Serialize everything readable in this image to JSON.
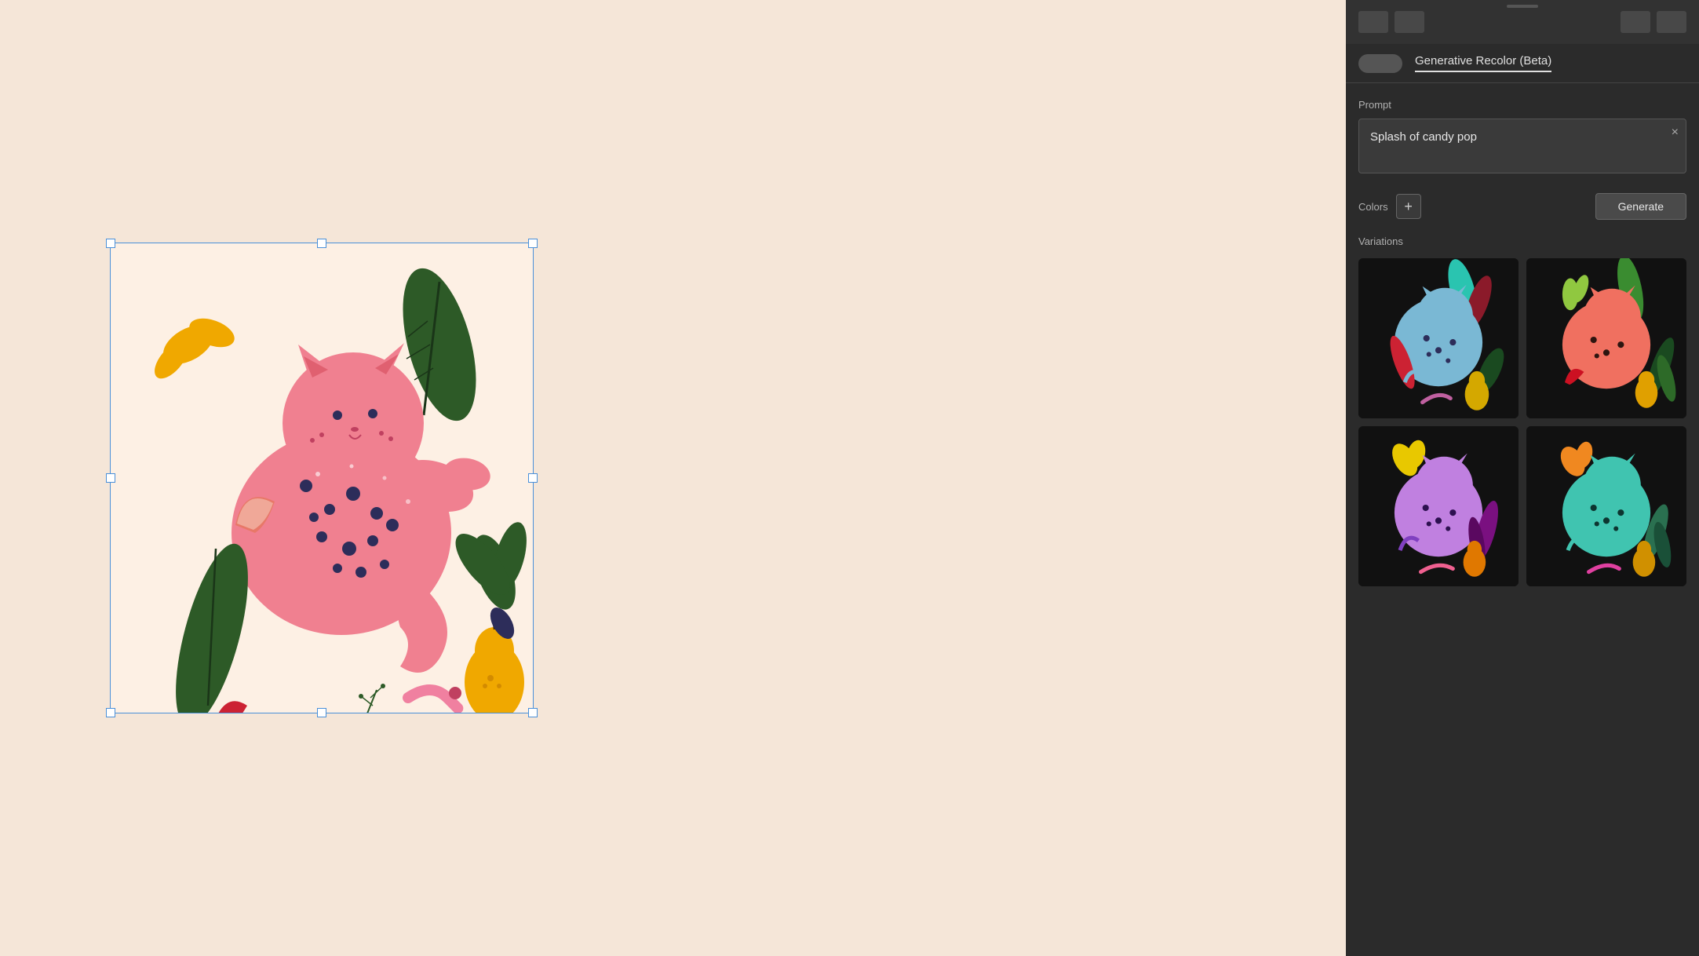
{
  "canvas": {
    "background_color": "#f5e6d8"
  },
  "panel": {
    "drag_handle": true,
    "toolbar": {
      "left_buttons": [
        "btn1",
        "btn2"
      ],
      "right_buttons": [
        "btn3",
        "btn4"
      ]
    },
    "tab_label": "Generative Recolor (Beta)",
    "prompt": {
      "label": "Prompt",
      "value": "Splash of candy pop",
      "clear_label": "×"
    },
    "colors": {
      "label": "Colors",
      "add_label": "+",
      "generate_label": "Generate"
    },
    "variations": {
      "label": "Variations",
      "items": [
        {
          "id": "var1",
          "scheme": "blue-dark"
        },
        {
          "id": "var2",
          "scheme": "coral-dark"
        },
        {
          "id": "var3",
          "scheme": "purple-dark"
        },
        {
          "id": "var4",
          "scheme": "teal-dark"
        }
      ]
    }
  }
}
